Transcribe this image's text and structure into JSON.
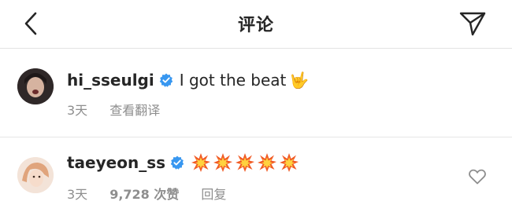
{
  "header": {
    "title": "评论",
    "back_icon": "chevron-left-icon",
    "send_icon": "paper-plane-icon"
  },
  "caption": {
    "username": "hi_sseulgi",
    "text": "I got the beat",
    "emoji": "🤟",
    "time": "3天",
    "translate_label": "查看翻译"
  },
  "comment": {
    "username": "taeyeon_ss",
    "emoji_name": "collision-icon",
    "emoji_count": 5,
    "time": "3天",
    "likes": "9,728 次赞",
    "reply_label": "回复",
    "like_icon": "heart-outline-icon"
  },
  "colors": {
    "text": "#262626",
    "secondary": "#8e8e8e",
    "verified": "#3897f0",
    "divider": "#e3e3e3"
  }
}
